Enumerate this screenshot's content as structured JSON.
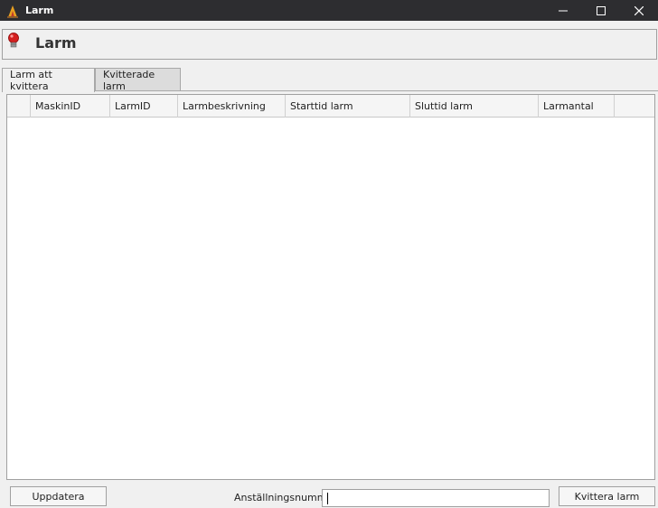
{
  "window": {
    "title": "Larm"
  },
  "header": {
    "title": "Larm"
  },
  "tabs": [
    {
      "label": "Larm att kvittera",
      "active": true
    },
    {
      "label": "Kvitterade larm",
      "active": false
    }
  ],
  "grid": {
    "columns": [
      "MaskinID",
      "LarmID",
      "Larmbeskrivning",
      "Starttid larm",
      "Sluttid larm",
      "Larmantal"
    ],
    "rows": []
  },
  "footer": {
    "update_label": "Uppdatera",
    "employee_label": "Anställningsnummer",
    "employee_value": "",
    "acknowledge_label": "Kvittera larm"
  },
  "colors": {
    "titlebar_bg": "#2d2d30",
    "window_bg": "#f0f0f0",
    "grid_bg": "#ffffff"
  },
  "icons": {
    "app": "fire-warning-icon",
    "header": "red-alarm-bulb-icon",
    "minimize": "minimize-icon",
    "maximize": "maximize-icon",
    "close": "close-icon"
  }
}
